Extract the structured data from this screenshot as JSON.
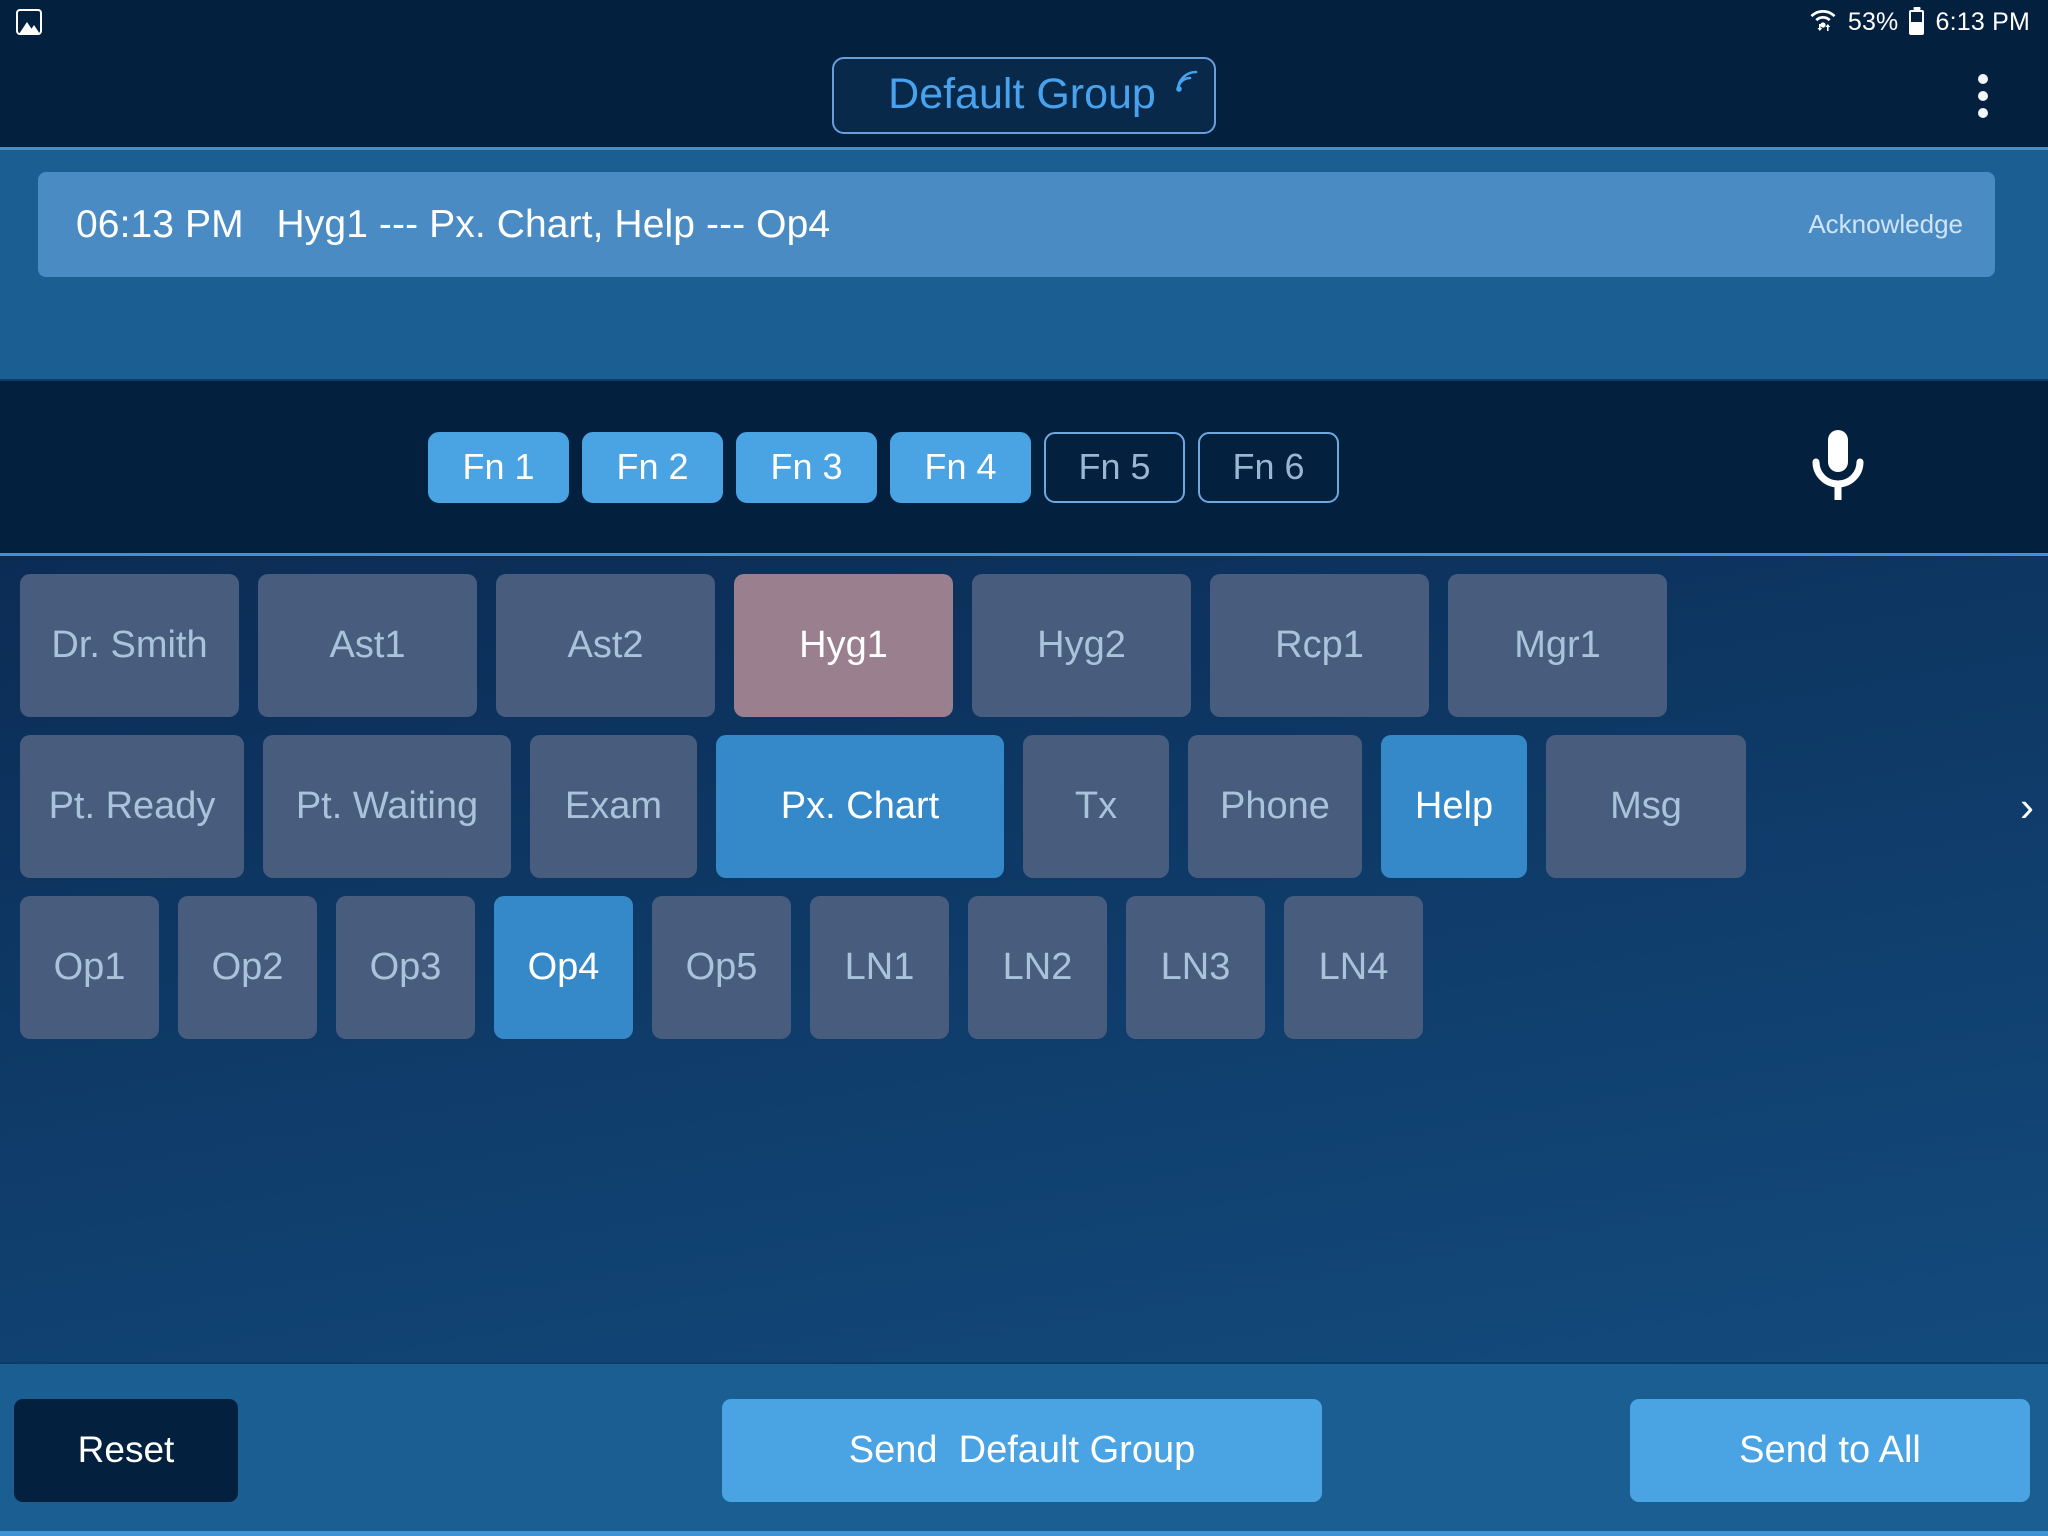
{
  "statusbar": {
    "photo_icon": "photo-icon",
    "wifi_icon": "wifi-updown-icon",
    "battery_pct": "53%",
    "battery_icon": "battery-icon",
    "time": "6:13 PM"
  },
  "appbar": {
    "group_label": "Default Group",
    "broadcast_icon": "broadcast-signal-icon",
    "overflow_icon": "overflow-menu-icon"
  },
  "message": {
    "time": "06:13 PM",
    "text": "06:13 PM   Hyg1 --- Px. Chart, Help --- Op4",
    "acknowledge_label": "Acknowledge"
  },
  "fn_row": {
    "mic_icon": "microphone-icon",
    "buttons": [
      {
        "label": "Fn 1",
        "active": true
      },
      {
        "label": "Fn 2",
        "active": true
      },
      {
        "label": "Fn 3",
        "active": true
      },
      {
        "label": "Fn 4",
        "active": true
      },
      {
        "label": "Fn 5",
        "active": false
      },
      {
        "label": "Fn 6",
        "active": false
      }
    ]
  },
  "tiles": {
    "row1": [
      {
        "label": "Dr. Smith",
        "state": "idle"
      },
      {
        "label": "Ast1",
        "state": "idle"
      },
      {
        "label": "Ast2",
        "state": "idle"
      },
      {
        "label": "Hyg1",
        "state": "alert"
      },
      {
        "label": "Hyg2",
        "state": "idle"
      },
      {
        "label": "Rcp1",
        "state": "idle"
      },
      {
        "label": "Mgr1",
        "state": "idle"
      }
    ],
    "row2": [
      {
        "label": "Pt. Ready",
        "state": "idle"
      },
      {
        "label": "Pt. Waiting",
        "state": "idle"
      },
      {
        "label": "Exam",
        "state": "idle"
      },
      {
        "label": "Px. Chart",
        "state": "selected"
      },
      {
        "label": "Tx",
        "state": "idle"
      },
      {
        "label": "Phone",
        "state": "idle"
      },
      {
        "label": "Help",
        "state": "selected"
      },
      {
        "label": "Msg",
        "state": "idle"
      }
    ],
    "row2_overflow_icon": "chevron-right-icon",
    "row3": [
      {
        "label": "Op1",
        "state": "idle"
      },
      {
        "label": "Op2",
        "state": "idle"
      },
      {
        "label": "Op3",
        "state": "idle"
      },
      {
        "label": "Op4",
        "state": "selected"
      },
      {
        "label": "Op5",
        "state": "idle"
      },
      {
        "label": "LN1",
        "state": "idle"
      },
      {
        "label": "LN2",
        "state": "idle"
      },
      {
        "label": "LN3",
        "state": "idle"
      },
      {
        "label": "LN4",
        "state": "idle"
      }
    ]
  },
  "footer": {
    "reset_label": "Reset",
    "send_group_label": "Send  Default Group",
    "send_all_label": "Send to All"
  },
  "colors": {
    "app_bar": "#04203f",
    "message_panel": "#1b5e92",
    "message_card": "#4b8bc4",
    "accent_blue": "#4aa3e3",
    "selected_tile": "#3589c9",
    "idle_tile": "#485d7d",
    "alert_tile": "#9a7f8e",
    "group_text": "#49a2ee"
  }
}
